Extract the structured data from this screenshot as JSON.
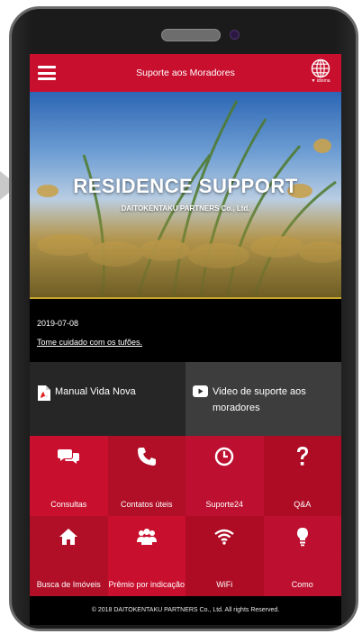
{
  "header": {
    "title": "Suporte aos Moradores",
    "language_label": "▼ idioma",
    "menu_icon": "hamburger-icon",
    "language_icon": "globe-icon",
    "brand_color": "#c8102e"
  },
  "hero": {
    "title": "RESIDENCE SUPPORT",
    "subtitle": "DAITOKENTAKU PARTNERS Co., Ltd."
  },
  "news": {
    "date": "2019-07-08",
    "link_text": "Tome cuidado com os tufões."
  },
  "quick_links": [
    {
      "label": "Manual Vida Nova",
      "icon": "pdf-icon"
    },
    {
      "label": "Video de suporte aos moradores",
      "icon": "youtube-icon"
    }
  ],
  "tiles": [
    {
      "label": "Consultas",
      "icon": "chat-bubbles-icon"
    },
    {
      "label": "Contatos úteis",
      "icon": "phone-icon"
    },
    {
      "label": "Suporte24",
      "icon": "clock-icon"
    },
    {
      "label": "Q&A",
      "icon": "question-icon"
    },
    {
      "label": "Busca de Imóveis",
      "icon": "home-icon"
    },
    {
      "label": "Prêmio por indicação",
      "icon": "people-icon"
    },
    {
      "label": "WiFi",
      "icon": "wifi-icon"
    },
    {
      "label": "Como",
      "icon": "lightbulb-icon"
    }
  ],
  "footer": {
    "copyright": "© 2018 DAITOKENTAKU PARTNERS Co., Ltd. All rights Reserved."
  }
}
